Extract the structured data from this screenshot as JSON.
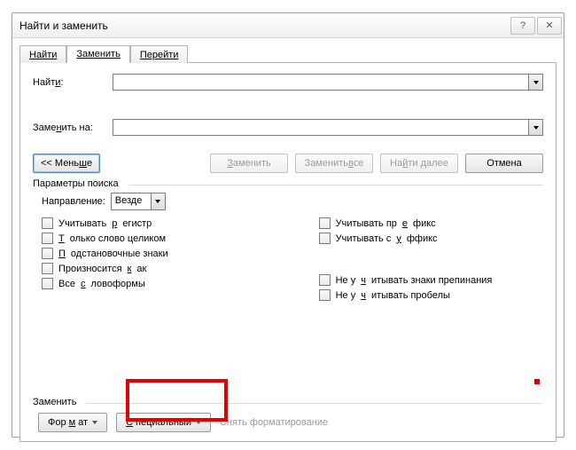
{
  "window": {
    "title": "Найти и заменить"
  },
  "tabs": {
    "find": "Найти",
    "replace": "Заменить",
    "goto": "Перейти"
  },
  "labels": {
    "find": "Найти:",
    "replace_with": "Заменить на:"
  },
  "buttons": {
    "less": "<< Меньше",
    "replace": "Заменить",
    "replace_all": "Заменить все",
    "find_next": "Найти далее",
    "cancel": "Отмена",
    "format": "Формат",
    "special": "Специальный",
    "clear_format": "Снять форматирование"
  },
  "search_options": {
    "header": "Параметры поиска",
    "direction_label": "Направление:",
    "direction_value": "Везде",
    "match_case": "Учитывать регистр",
    "whole_word": "Только слово целиком",
    "wildcards": "Подстановочные знаки",
    "sounds_like": "Произносится как",
    "word_forms": "Все словоформы",
    "match_prefix": "Учитывать префикс",
    "match_suffix": "Учитывать суффикс",
    "ignore_punct": "Не учитывать знаки препинания",
    "ignore_space": "Не учитывать пробелы"
  },
  "bottom_header": "Заменить"
}
